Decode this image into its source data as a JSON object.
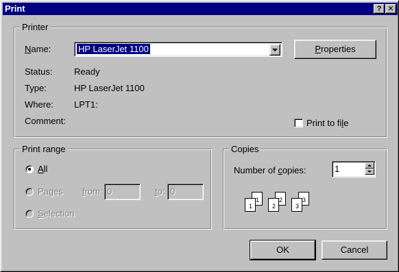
{
  "window": {
    "title": "Print",
    "help_glyph": "?",
    "close_glyph": "✕"
  },
  "printer": {
    "group_label": "Printer",
    "name_label": "Name:",
    "name_value": "HP LaserJet 1100",
    "properties_label": "Properties",
    "status_label": "Status:",
    "status_value": "Ready",
    "type_label": "Type:",
    "type_value": "HP LaserJet 1100",
    "where_label": "Where:",
    "where_value": "LPT1:",
    "comment_label": "Comment:",
    "comment_value": "",
    "print_to_file_label": "Print to file",
    "print_to_file_checked": false
  },
  "print_range": {
    "group_label": "Print range",
    "all_label": "All",
    "pages_label": "Pages",
    "from_label": "from:",
    "from_value": "0",
    "to_label": "to:",
    "to_value": "0",
    "selection_label": "Selection",
    "selected": "All"
  },
  "copies": {
    "group_label": "Copies",
    "number_label": "Number of copies:",
    "number_value": "1",
    "collate_pages": [
      "1",
      "1",
      "2",
      "2",
      "3",
      "3"
    ]
  },
  "buttons": {
    "ok_label": "OK",
    "cancel_label": "Cancel"
  },
  "colors": {
    "dialog_face": "#c0c0c0",
    "title_bar": "#000080",
    "selection": "#000080",
    "disabled_text": "#808080"
  }
}
